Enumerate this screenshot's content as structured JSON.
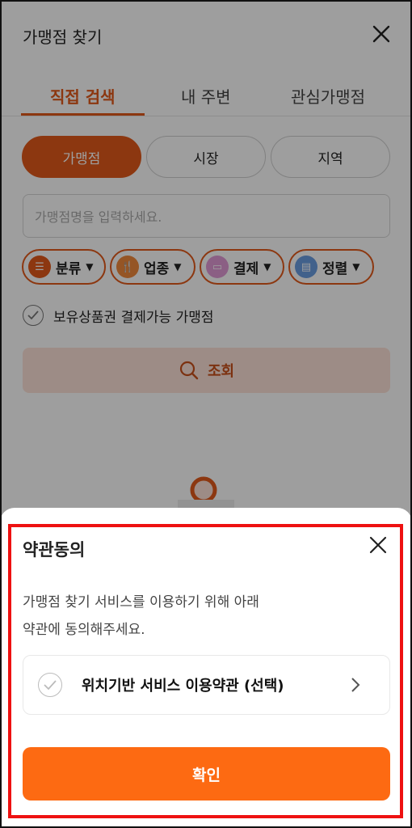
{
  "header": {
    "title": "가맹점 찾기"
  },
  "tabs": [
    {
      "label": "직접 검색",
      "active": true
    },
    {
      "label": "내 주변",
      "active": false
    },
    {
      "label": "관심가맹점",
      "active": false
    }
  ],
  "segments": [
    {
      "label": "가맹점",
      "active": true
    },
    {
      "label": "시장",
      "active": false
    },
    {
      "label": "지역",
      "active": false
    }
  ],
  "search": {
    "placeholder": "가맹점명을 입력하세요."
  },
  "filters": [
    {
      "label": "분류",
      "icon": "list-icon",
      "color": "#e35a1a"
    },
    {
      "label": "업종",
      "icon": "utensils-icon",
      "color": "#f08a3c"
    },
    {
      "label": "결제",
      "icon": "card-icon",
      "color": "#e09ad6"
    },
    {
      "label": "정렬",
      "icon": "sort-icon",
      "color": "#6a9de0"
    }
  ],
  "voucher_filter": {
    "label": "보유상품권 결제가능 가맹점"
  },
  "search_button": {
    "label": "조회"
  },
  "sheet": {
    "title": "약관동의",
    "description_line1": "가맹점 찾기 서비스를 이용하기 위해 아래",
    "description_line2": "약관에 동의해주세요.",
    "terms_item": {
      "label": "위치기반 서비스 이용약관 (선택)"
    },
    "confirm_label": "확인"
  },
  "colors": {
    "accent": "#e35a1a",
    "confirm": "#fd6a12",
    "highlight_outline": "#ee1111"
  }
}
